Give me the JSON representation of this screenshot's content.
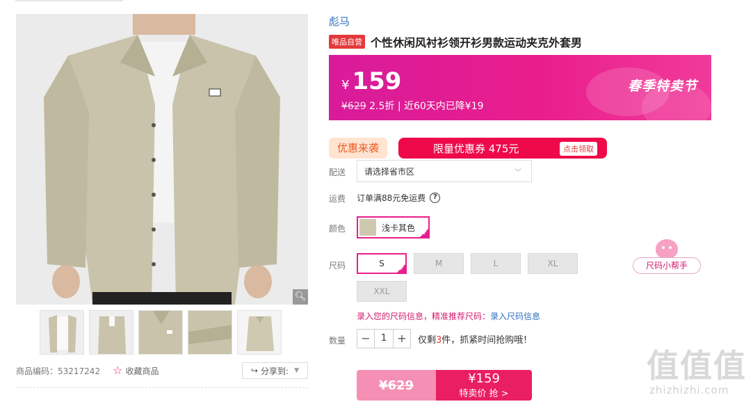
{
  "brand": "彪马",
  "product": {
    "tag": "唯品自营",
    "title": "个性休闲风衬衫领开衫男款运动夹克外套男",
    "code_label": "商品编码：53217242",
    "favorite_label": "收藏商品",
    "share_label": "分享到:"
  },
  "price": {
    "currency": "¥",
    "current": "159",
    "original": "¥629",
    "discount": "2.5折",
    "note": "| 近60天内已降¥19",
    "festival": "春季特卖节"
  },
  "promo": {
    "tag": "优惠来袭",
    "coupon": "限量优惠券 475元",
    "coupon_btn": "点击领取"
  },
  "delivery": {
    "label": "配送",
    "placeholder": "请选择省市区"
  },
  "shipping": {
    "label": "运费",
    "text": "订单满88元免运费",
    "help": "?"
  },
  "color": {
    "label": "颜色",
    "selected": "浅卡其色"
  },
  "size": {
    "label": "尺码",
    "options": [
      "S",
      "M",
      "L",
      "XL",
      "XXL"
    ],
    "selected": "S",
    "helper": "尺码小帮手",
    "info_text": "录入您的尺码信息，精准推荐尺码：",
    "info_link": "录入尺码信息"
  },
  "quantity": {
    "label": "数量",
    "value": "1",
    "note_prefix": "仅剩",
    "note_count": "3",
    "note_suffix": "件，抓紧时间抢购哦！"
  },
  "buy": {
    "original": "¥629",
    "price": "¥159",
    "action": "特卖价 抢 >"
  },
  "watermark": {
    "text": "值值值",
    "url": "zhizhizhi.com"
  },
  "colors": {
    "accent": "#e91e8c",
    "link": "#2f6fc0",
    "coupon": "#ee0a4a"
  }
}
